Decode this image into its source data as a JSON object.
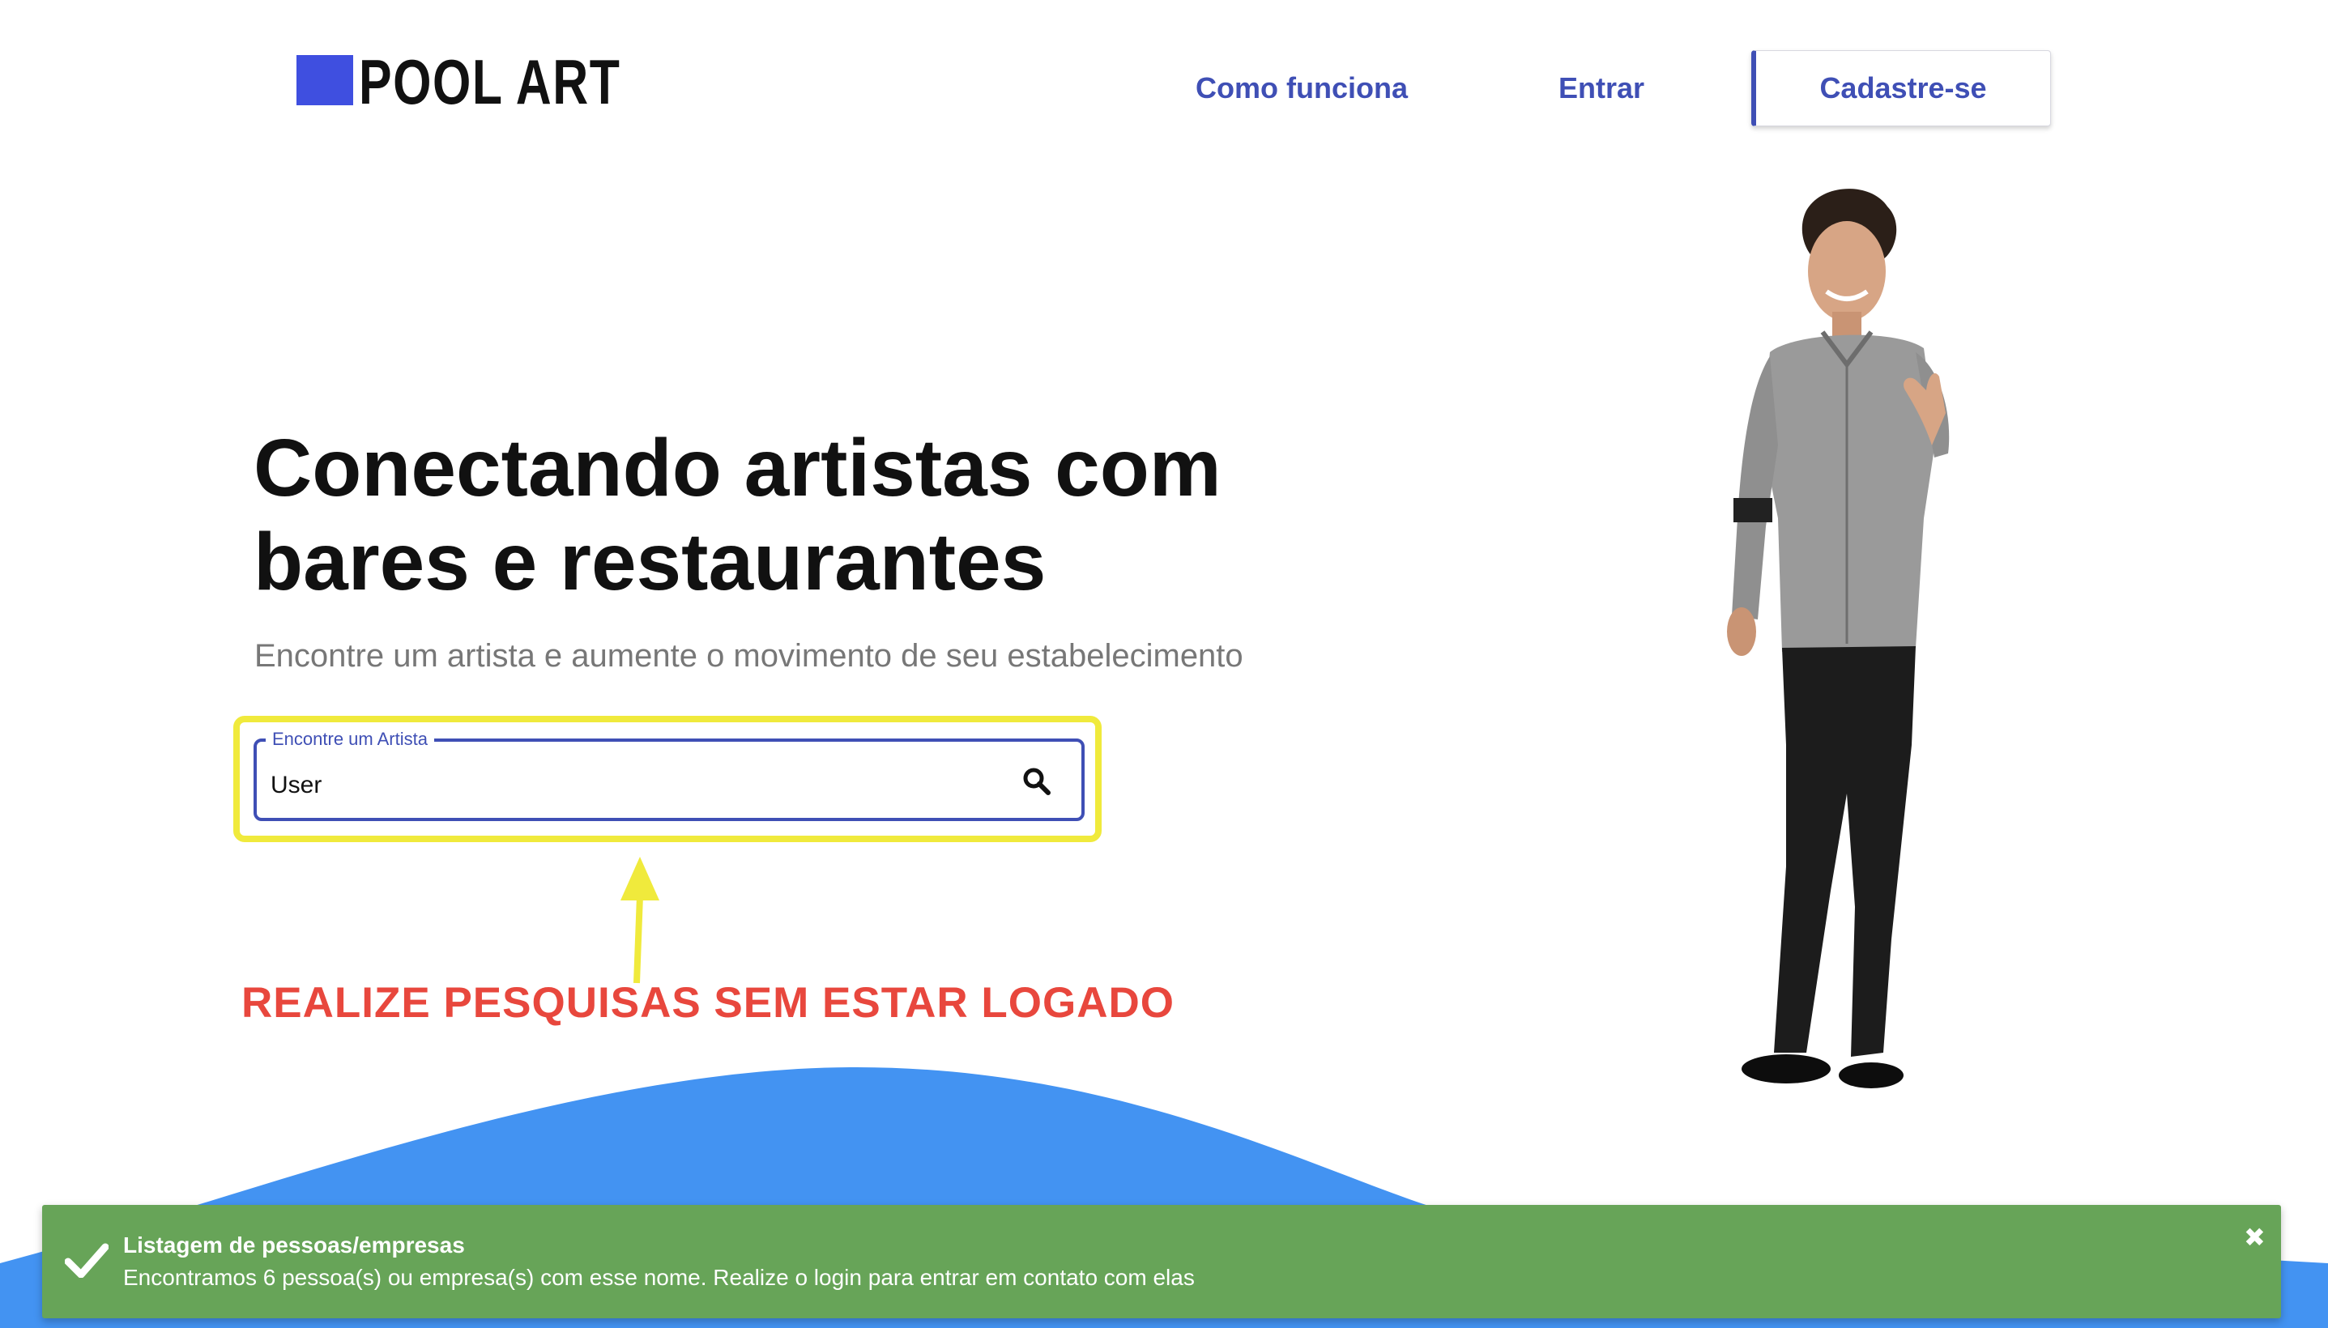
{
  "header": {
    "logo_text": "POOL ART",
    "nav": {
      "how_it_works": "Como funciona",
      "login": "Entrar",
      "signup": "Cadastre-se"
    }
  },
  "hero": {
    "title_line1": "Conectando artistas com",
    "title_line2": "bares e restaurantes",
    "subtitle": "Encontre um artista e aumente o movimento de seu estabelecimento"
  },
  "search": {
    "label": "Encontre um Artista",
    "value": "User",
    "icon": "search-icon"
  },
  "annotation": {
    "text": "REALIZE PESQUISAS SEM ESTAR LOGADO",
    "color": "#e8473d",
    "highlight_color": "#f0ea3c"
  },
  "toast": {
    "title": "Listagem de pessoas/empresas",
    "message": "Encontramos 6 pessoa(s) ou empresa(s) com esse nome. Realize o login para entrar em contato com elas",
    "close": "✖",
    "color": "#67a458"
  },
  "colors": {
    "brand": "#3f4fe0",
    "nav_text": "#3f4fb5",
    "wave": "#4393f2"
  }
}
